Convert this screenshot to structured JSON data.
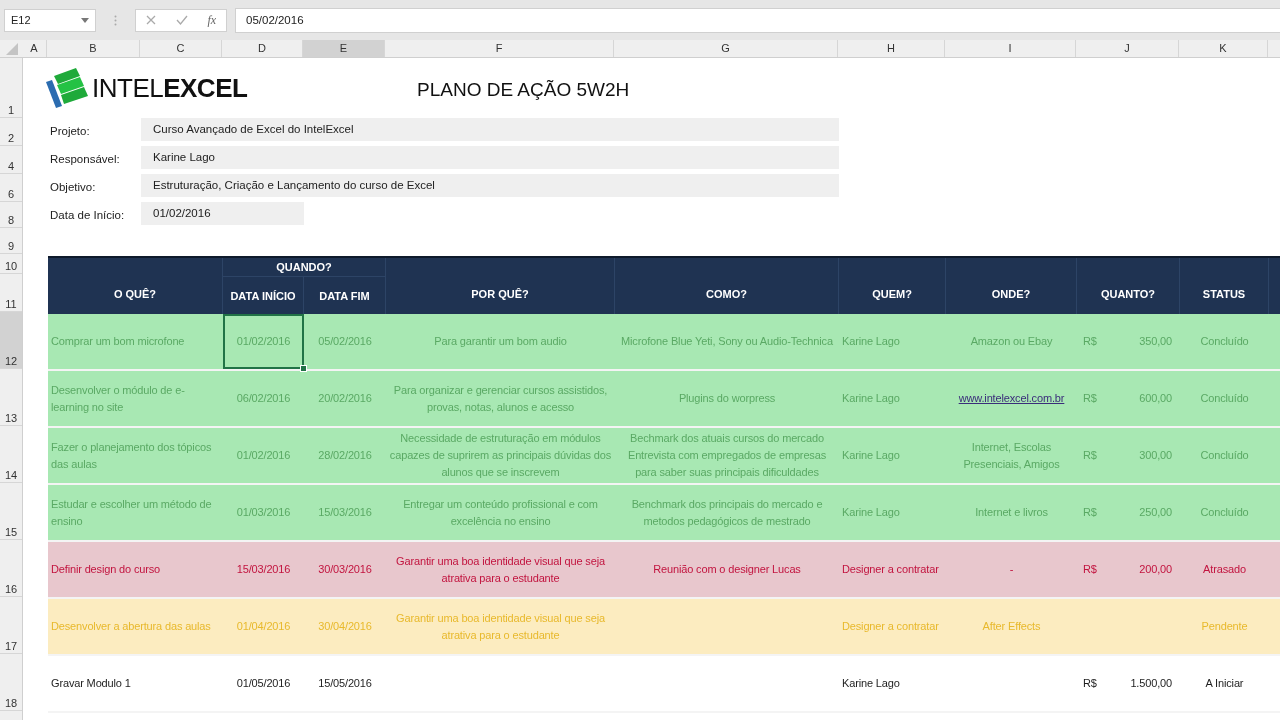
{
  "formula_bar": {
    "name_box": "E12",
    "function_label": "fx",
    "formula": "05/02/2016"
  },
  "columns": [
    {
      "label": "A",
      "selected": false
    },
    {
      "label": "B",
      "selected": false
    },
    {
      "label": "C",
      "selected": false
    },
    {
      "label": "D",
      "selected": false
    },
    {
      "label": "E",
      "selected": true
    },
    {
      "label": "F",
      "selected": false
    },
    {
      "label": "G",
      "selected": false
    },
    {
      "label": "H",
      "selected": false
    },
    {
      "label": "I",
      "selected": false
    },
    {
      "label": "J",
      "selected": false
    },
    {
      "label": "K",
      "selected": false
    }
  ],
  "row_headers": [
    {
      "label": "1",
      "selected": false
    },
    {
      "label": "2",
      "selected": false
    },
    {
      "label": "4",
      "selected": false
    },
    {
      "label": "6",
      "selected": false
    },
    {
      "label": "8",
      "selected": false
    },
    {
      "label": "9",
      "selected": false
    },
    {
      "label": "10",
      "selected": false
    },
    {
      "label": "11",
      "selected": false
    },
    {
      "label": "12",
      "selected": true
    },
    {
      "label": "13",
      "selected": false
    },
    {
      "label": "14",
      "selected": false
    },
    {
      "label": "15",
      "selected": false
    },
    {
      "label": "16",
      "selected": false
    },
    {
      "label": "17",
      "selected": false
    },
    {
      "label": "18",
      "selected": false
    }
  ],
  "logo": {
    "text_light": "INTEL",
    "text_bold": "EXCEL"
  },
  "title": "PLANO DE AÇÃO 5W2H",
  "info": [
    {
      "label": "Projeto:",
      "value": "Curso Avançado de Excel do IntelExcel",
      "kind": "text"
    },
    {
      "label": "Responsável:",
      "value": "Karine Lago",
      "kind": "text"
    },
    {
      "label": "Objetivo:",
      "value": "Estruturação, Criação e Lançamento do curso de Excel",
      "kind": "text"
    },
    {
      "label": "Data de Início:",
      "value": "01/02/2016",
      "kind": "date"
    }
  ],
  "header": {
    "what": "O QUÊ?",
    "when": "QUANDO?",
    "start": "DATA INÍCIO",
    "end": "DATA FIM",
    "why": "POR QUÊ?",
    "how": "COMO?",
    "who": "QUEM?",
    "where": "ONDE?",
    "how_much": "QUANTO?",
    "status": "STATUS"
  },
  "rows": [
    {
      "kind": "done",
      "start_selected": true,
      "what": "Comprar um bom microfone",
      "start": "01/02/2016",
      "end": "05/02/2016",
      "why": "Para garantir um bom audio",
      "how": "Microfone Blue Yeti, Sony ou Audio-Technica",
      "who": "Karine Lago",
      "where": "Amazon ou Ebay",
      "where_is_link": false,
      "currency": "R$",
      "amount": "350,00",
      "status": "Concluído"
    },
    {
      "kind": "done",
      "start_selected": false,
      "what": "Desenvolver o módulo de e-learning no site",
      "start": "06/02/2016",
      "end": "20/02/2016",
      "why": "Para organizar e gerenciar cursos assistidos, provas, notas, alunos e acesso",
      "how": "Plugins do worpress",
      "who": "Karine Lago",
      "where": "www.intelexcel.com.br",
      "where_is_link": true,
      "currency": "R$",
      "amount": "600,00",
      "status": "Concluído"
    },
    {
      "kind": "done",
      "start_selected": false,
      "what": "Fazer o planejamento dos tópicos das aulas",
      "start": "01/02/2016",
      "end": "28/02/2016",
      "why": "Necessidade de estruturação em módulos capazes de suprirem as principais dúvidas dos alunos que se inscrevem",
      "how": "Bechmark dos atuais cursos do mercado Entrevista com empregados de empresas para saber suas principais dificuldades",
      "who": "Karine Lago",
      "where": "Internet, Escolas Presenciais, Amigos",
      "where_is_link": false,
      "currency": "R$",
      "amount": "300,00",
      "status": "Concluído"
    },
    {
      "kind": "done",
      "start_selected": false,
      "what": "Estudar e escolher um método de ensino",
      "start": "01/03/2016",
      "end": "15/03/2016",
      "why": "Entregar um conteúdo profissional e com excelência no ensino",
      "how": "Benchmark dos principais do mercado e metodos pedagógicos de mestrado",
      "who": "Karine Lago",
      "where": "Internet e livros",
      "where_is_link": false,
      "currency": "R$",
      "amount": "250,00",
      "status": "Concluído"
    },
    {
      "kind": "late",
      "start_selected": false,
      "what": "Definir design do curso",
      "start": "15/03/2016",
      "end": "30/03/2016",
      "why": "Garantir uma boa identidade visual que seja atrativa para o estudante",
      "how": "Reunião com o designer Lucas",
      "who": "Designer a contratar",
      "where": "-",
      "where_is_link": false,
      "currency": "R$",
      "amount": "200,00",
      "status": "Atrasado"
    },
    {
      "kind": "pending",
      "start_selected": false,
      "what": "Desenvolver a abertura das aulas",
      "start": "01/04/2016",
      "end": "30/04/2016",
      "why": "Garantir uma boa identidade visual que seja atrativa para o estudante",
      "who": "Designer a contratar",
      "where": "After Effects",
      "where_is_link": false,
      "status": "Pendente"
    },
    {
      "kind": "new",
      "start_selected": false,
      "what": "Gravar Modulo 1",
      "start": "01/05/2016",
      "end": "15/05/2016",
      "who": "Karine Lago",
      "currency": "R$",
      "amount": "1.500,00",
      "status": "A Iniciar"
    }
  ]
}
